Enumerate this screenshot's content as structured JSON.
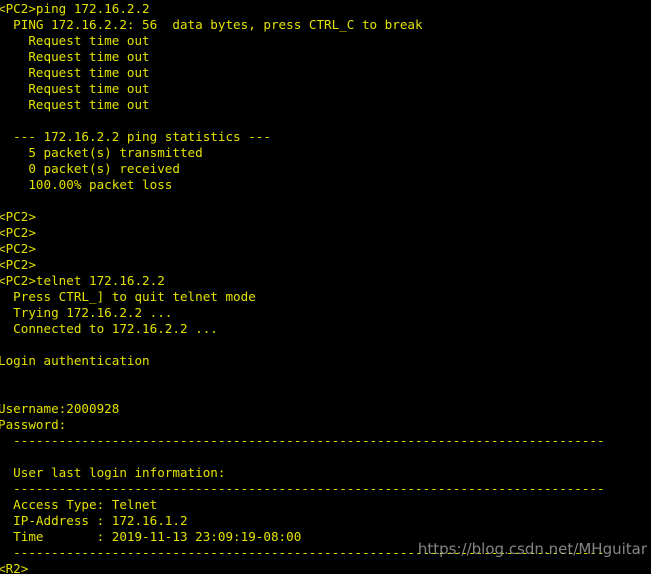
{
  "terminal": {
    "background_color": "#000000",
    "text_color": "#e2e200",
    "prompt_pc": "<PC2>",
    "prompt_router": "<R2>",
    "lines": [
      "<PC2>ping 172.16.2.2",
      "  PING 172.16.2.2: 56  data bytes, press CTRL_C to break",
      "    Request time out",
      "    Request time out",
      "    Request time out",
      "    Request time out",
      "    Request time out",
      "",
      "  --- 172.16.2.2 ping statistics ---",
      "    5 packet(s) transmitted",
      "    0 packet(s) received",
      "    100.00% packet loss",
      "",
      "<PC2>",
      "<PC2>",
      "<PC2>",
      "<PC2>",
      "<PC2>telnet 172.16.2.2",
      "  Press CTRL_] to quit telnet mode",
      "  Trying 172.16.2.2 ...",
      "  Connected to 172.16.2.2 ...",
      "",
      "Login authentication",
      "",
      "",
      "Username:2000928",
      "Password:",
      "  ------------------------------------------------------------------------------",
      "",
      "  User last login information:",
      "  ------------------------------------------------------------------------------",
      "  Access Type: Telnet",
      "  IP-Address : 172.16.1.2",
      "  Time       : 2019-11-13 23:09:19-08:00",
      "  ------------------------------------------------------------------------------",
      "<R2>"
    ]
  },
  "watermark": {
    "text": "https://blog.csdn.net/MHguitar"
  }
}
